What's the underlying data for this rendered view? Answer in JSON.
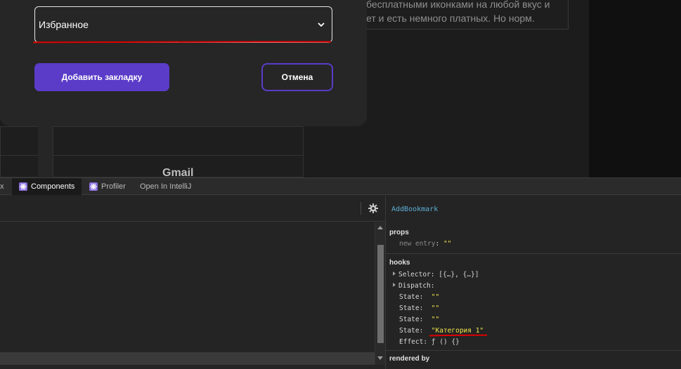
{
  "background": {
    "card_text_line1": "бесплатными иконками на любой вкус и",
    "card_text_line2": "ет и есть немного платных. Но норм.",
    "card_title": "Gmail"
  },
  "modal": {
    "select_value": "Избранное",
    "add_button": "Добавить закладку",
    "cancel_button": "Отмена"
  },
  "devtools": {
    "tabs": [
      {
        "label": "x"
      },
      {
        "label": "Components",
        "active": true
      },
      {
        "label": "Profiler"
      },
      {
        "label": "Open In IntelliJ"
      }
    ],
    "selected_component": "AddBookmark",
    "props_title": "props",
    "props": [
      {
        "key": "new entry",
        "value": "\"\""
      }
    ],
    "hooks_title": "hooks",
    "hooks": [
      {
        "key": "Selector",
        "value": "[{…}, {…}]"
      },
      {
        "key": "Dispatch",
        "value": ""
      },
      {
        "key": "State",
        "value": "\"\""
      },
      {
        "key": "State",
        "value": "\"\""
      },
      {
        "key": "State",
        "value": "\"\""
      },
      {
        "key": "State",
        "value": "\"Категория 1\""
      },
      {
        "key": "Effect",
        "value": "ƒ () {}"
      }
    ],
    "rendered_by_title": "rendered by"
  },
  "colors": {
    "accent": "#5a3cc8",
    "string_value": "#f5e94c",
    "component_name": "#5db0d7",
    "annotation_red": "#e00000"
  }
}
